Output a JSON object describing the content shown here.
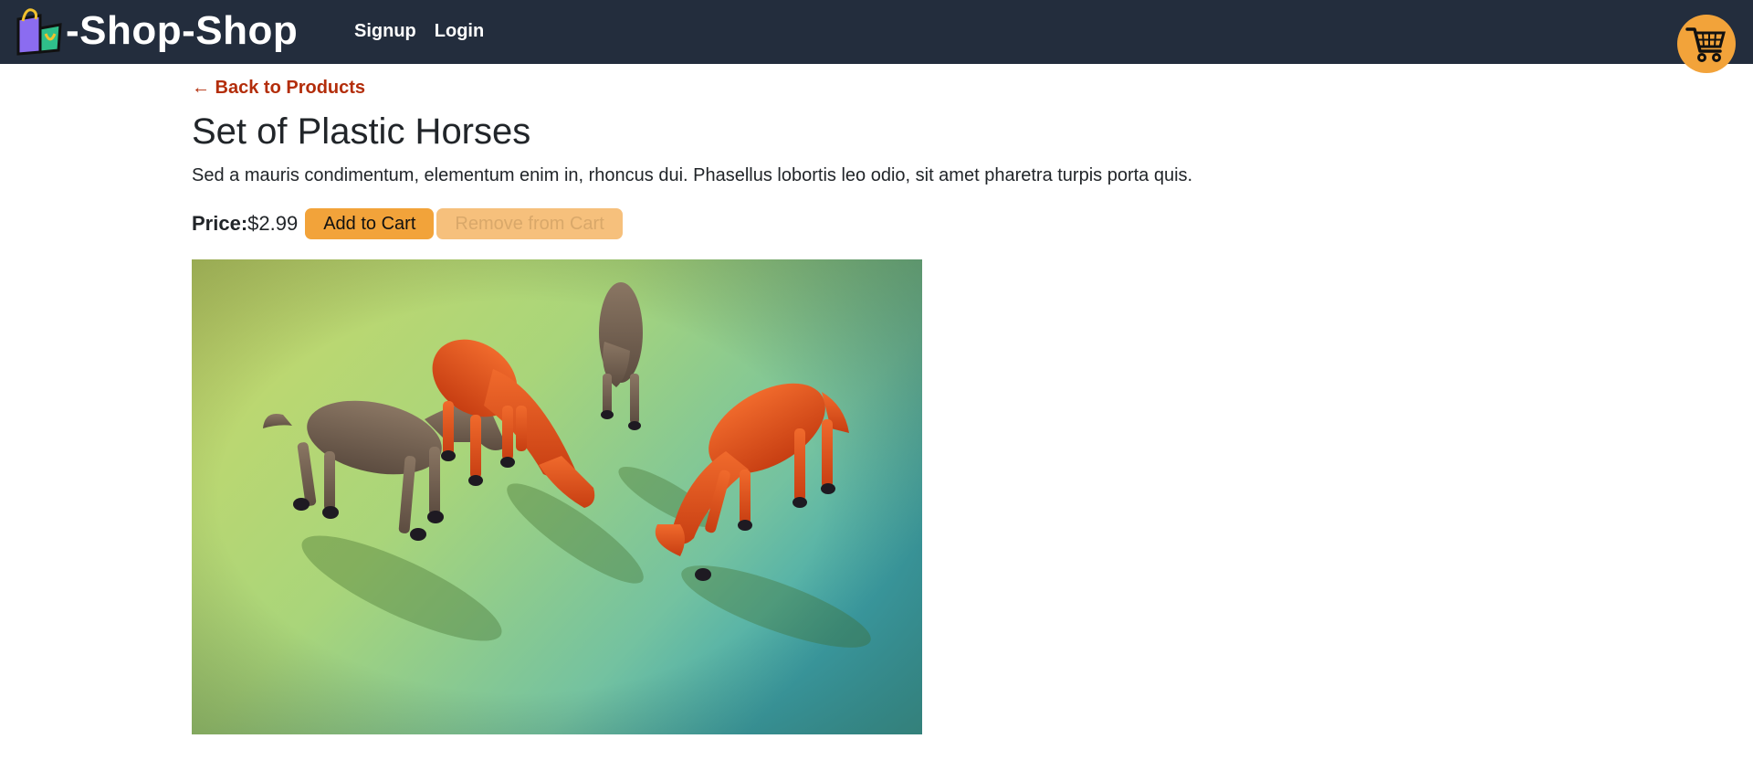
{
  "header": {
    "brand_text": "-Shop-Shop",
    "nav": {
      "signup": "Signup",
      "login": "Login"
    },
    "cart_icon": "shopping-cart-icon"
  },
  "product": {
    "back_link": "← Back to Products",
    "title": "Set of Plastic Horses",
    "description": "Sed a mauris condimentum, elementum enim in, rhoncus dui. Phasellus lobortis leo odio, sit amet pharetra turpis porta quis.",
    "price_label": "Price:",
    "price_value": "$2.99",
    "add_button": "Add to Cart",
    "remove_button": "Remove from Cart",
    "remove_disabled": true
  },
  "colors": {
    "navbar_bg": "#232d3d",
    "accent": "#f2a33a",
    "link": "#b32d0a"
  }
}
